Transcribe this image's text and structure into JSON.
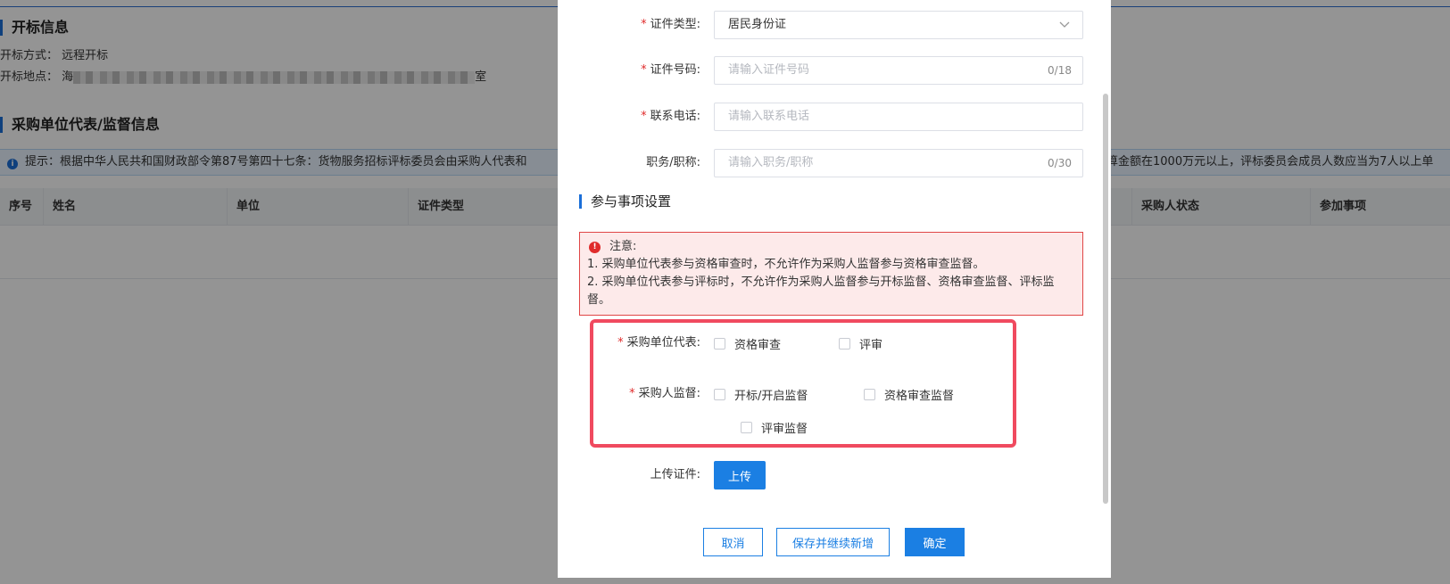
{
  "background": {
    "section1_title": "开标信息",
    "open_method_label": "开标方式：",
    "open_method_value": "远程开标",
    "open_place_label": "开标地点：",
    "open_place_prefix": "海",
    "open_place_suffix": "室",
    "section2_title": "采购单位代表/监督信息",
    "tip_text": "提示：根据中华人民共和国财政部令第87号第四十七条：货物服务招标评标委员会由采购人代表和",
    "tip_text_right": "算金额在1000万元以上，评标委员会成员人数应当为7人以上单",
    "columns": [
      "序号",
      "姓名",
      "单位",
      "证件类型",
      "采购人状态",
      "参加事项"
    ]
  },
  "dialog": {
    "id_type": {
      "label": "证件类型:",
      "value": "居民身份证"
    },
    "id_number": {
      "label": "证件号码:",
      "placeholder": "请输入证件号码",
      "count": "0/18"
    },
    "phone": {
      "label": "联系电话:",
      "placeholder": "请输入联系电话"
    },
    "title_field": {
      "label": "职务/职称:",
      "placeholder": "请输入职务/职称",
      "count": "0/30"
    },
    "section_title": "参与事项设置",
    "notice": {
      "title": "注意:",
      "line1": "1. 采购单位代表参与资格审查时，不允许作为采购人监督参与资格审查监督。",
      "line2": "2. 采购单位代表参与评标时，不允许作为采购人监督参与开标监督、资格审查监督、评标监督。"
    },
    "rep": {
      "label": "采购单位代表:",
      "options": [
        "资格审查",
        "评审"
      ]
    },
    "supervisor": {
      "label": "采购人监督:",
      "options": [
        "开标/开启监督",
        "资格审查监督",
        "评审监督"
      ]
    },
    "upload": {
      "label": "上传证件:",
      "button": "上传"
    },
    "buttons": {
      "cancel": "取消",
      "save_continue": "保存并继续新增",
      "confirm": "确定"
    }
  },
  "colors": {
    "primary": "#1b7fe3",
    "danger": "#e02b2b",
    "highlight": "#f04a5f"
  }
}
